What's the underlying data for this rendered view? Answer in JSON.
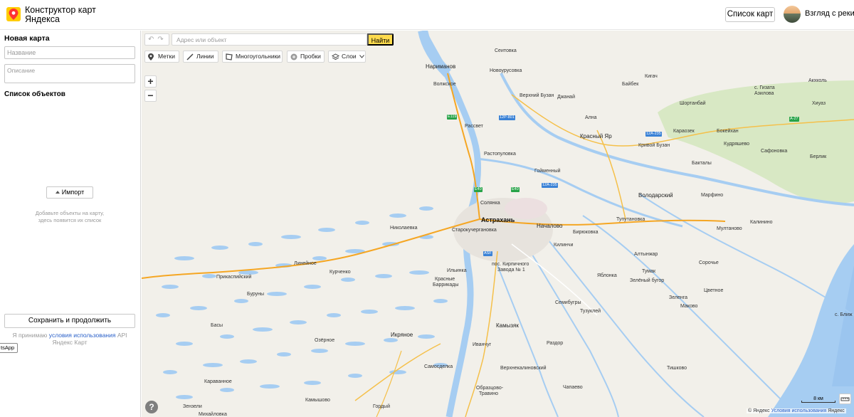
{
  "header": {
    "brand_line1": "Конструктор карт",
    "brand_line2": "Яндекса",
    "list_button": "Список карт",
    "user_name": "Взгляд с реки"
  },
  "sidebar": {
    "title": "Новая карта",
    "name_placeholder": "Название",
    "description_placeholder": "Описание",
    "objects_title": "Список объектов",
    "import_button": "Импорт",
    "empty_line1": "Добавьте объекты на карту,",
    "empty_line2": "здесь появится их список",
    "save_button": "Сохранить и продолжить",
    "terms_prefix": "Я принимаю",
    "terms_link": "условия использования",
    "terms_suffix": "API Яндекс Карт",
    "whatsapp_tab": "tsApp"
  },
  "map": {
    "undo": "↶",
    "redo": "↷",
    "search_placeholder": "Адрес или объект",
    "find_button": "Найти",
    "tools": {
      "marks": "Метки",
      "lines": "Линии",
      "polygons": "Многоугольники",
      "traffic": "Пробки",
      "layers": "Слои"
    },
    "zoom_in": "+",
    "zoom_out": "−",
    "help": "?",
    "scale": "8 км",
    "copyright_prefix": "© Яндекс",
    "copyright_link": "Условия использования",
    "copyright_suffix": "Яндекс",
    "labels": {
      "seitovka": "Сеитовка",
      "narimanov": "Нариманов",
      "novourusovka": "Новоурусовка",
      "volzhskoe": "Волжское",
      "verkhniy_buzan": "Верхний Бузан",
      "dzhanay": "Джанай",
      "kigach": "Кигач",
      "baybek": "Байбек",
      "akhkol": "Акхколь",
      "gizata": "с. Гизата",
      "azilova": "Азилова",
      "shortanby": "Шортанбай",
      "khiuaz": "Хиуаз",
      "rasset": "Рассвет",
      "alna": "Ална",
      "krasny_yar": "Красный Яр",
      "karaozek": "Караозек",
      "bokeyhan": "Бокейхан",
      "krivoy_buzan": "Кривой Бузан",
      "kudryashevo": "Кудряшево",
      "safonovka": "Сафоновка",
      "berlik": "Берлик",
      "rastopulovka": "Растопуловка",
      "bakhtane": "Бакталы",
      "goymenny": "Гойменный",
      "volodarsky": "Володарский",
      "marfino": "Марфино",
      "solyanka": "Солянка",
      "astrakhan": "Астрахань",
      "nachalovo": "Началово",
      "tuputanovka": "Тупутановка",
      "nikolaevka": "Николаевка",
      "starokucherganovka": "Старокучергановка",
      "birukovka": "Бирюковка",
      "multanovo": "Мултаново",
      "kalinino": "Калинино",
      "kilinchi": "Килинчи",
      "altynzhar": "Алтынжар",
      "kirpichny_1": "пос. Кирпичного",
      "kirpichny_2": "Завода № 1",
      "sorochie": "Сорочье",
      "linejnoe": "Линейное",
      "kurchenko": "Курченко",
      "ilinka": "Ильинка",
      "yablonka": "Яблонка",
      "tumak": "Тумак",
      "prikaspiysky": "Прикаспийский",
      "krasnye_barrikady_1": "Красные",
      "krasnye_barrikady_2": "Баррикады",
      "zeleny_bugor": "Зелёный бугор",
      "tsvetnoe": "Цветное",
      "buruny": "Буруны",
      "semibugry": "Семибугры",
      "zelenga": "Зеленга",
      "makovo": "Маково",
      "tuzukley": "Тузуклей",
      "basy": "Басы",
      "kamyzyak": "Камызяк",
      "ikryanoe": "Икряное",
      "ozyornoe": "Озёрное",
      "ivachug": "Иванчуг",
      "razdor": "Раздор",
      "samosdelka": "Самосделка",
      "verkhnekalinovsky": "Верхнекалиновский",
      "tishkovo": "Тишково",
      "karavannoe": "Караванное",
      "obrazcovo_1": "Образцово-",
      "obrazcovo_2": "Травино",
      "chapaevo": "Чапаево",
      "zenzeli": "Зензели",
      "kamyshovo": "Камышово",
      "gordyy": "Гордый",
      "mikhaylovka": "Михайловка",
      "blizhn": "с. Ближ"
    },
    "roads": {
      "e119": "E119",
      "r12_801": "12Р-801",
      "r12a_235_a": "12А-235",
      "r12a_235_b": "12А-235",
      "a27": "А-27",
      "e40_a": "E40",
      "e40_b": "E40",
      "asf": "ASF"
    }
  }
}
